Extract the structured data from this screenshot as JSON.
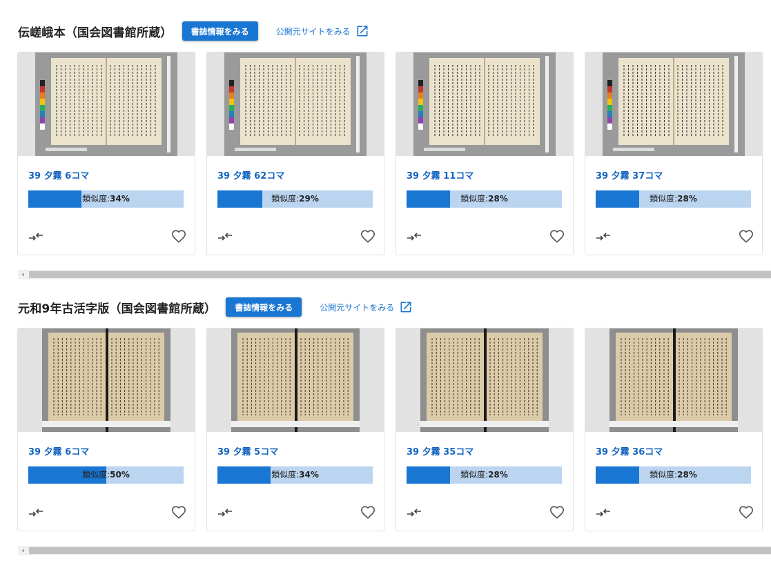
{
  "sections": [
    {
      "title": "伝嵯峨本（国会図書館所蔵）",
      "biblio_button": "書誌情報をみる",
      "site_link": "公開元サイトをみる",
      "cards": [
        {
          "frame": "39 夕霧 6コマ",
          "sim_label": "類似度:",
          "sim_value": "34%",
          "similarity": 0.34
        },
        {
          "frame": "39 夕霧 62コマ",
          "sim_label": "類似度:",
          "sim_value": "29%",
          "similarity": 0.29
        },
        {
          "frame": "39 夕霧 11コマ",
          "sim_label": "類似度:",
          "sim_value": "28%",
          "similarity": 0.28
        },
        {
          "frame": "39 夕霧 37コマ",
          "sim_label": "類似度:",
          "sim_value": "28%",
          "similarity": 0.28
        }
      ]
    },
    {
      "title": "元和9年古活字版（国会図書館所蔵）",
      "biblio_button": "書誌情報をみる",
      "site_link": "公開元サイトをみる",
      "cards": [
        {
          "frame": "39 夕霧 6コマ",
          "sim_label": "類似度:",
          "sim_value": "50%",
          "similarity": 0.5
        },
        {
          "frame": "39 夕霧 5コマ",
          "sim_label": "類似度:",
          "sim_value": "34%",
          "similarity": 0.34
        },
        {
          "frame": "39 夕霧 35コマ",
          "sim_label": "類似度:",
          "sim_value": "28%",
          "similarity": 0.28
        },
        {
          "frame": "39 夕霧 36コマ",
          "sim_label": "類似度:",
          "sim_value": "28%",
          "similarity": 0.28
        }
      ]
    }
  ],
  "icons": {
    "compare": "compare-arrows-icon",
    "favorite": "heart-outline-icon",
    "external": "open-in-new-icon"
  },
  "colors": {
    "accent": "#1976d2",
    "bar_bg": "#bbd5f1",
    "page_paper": "#e8dcc0"
  }
}
